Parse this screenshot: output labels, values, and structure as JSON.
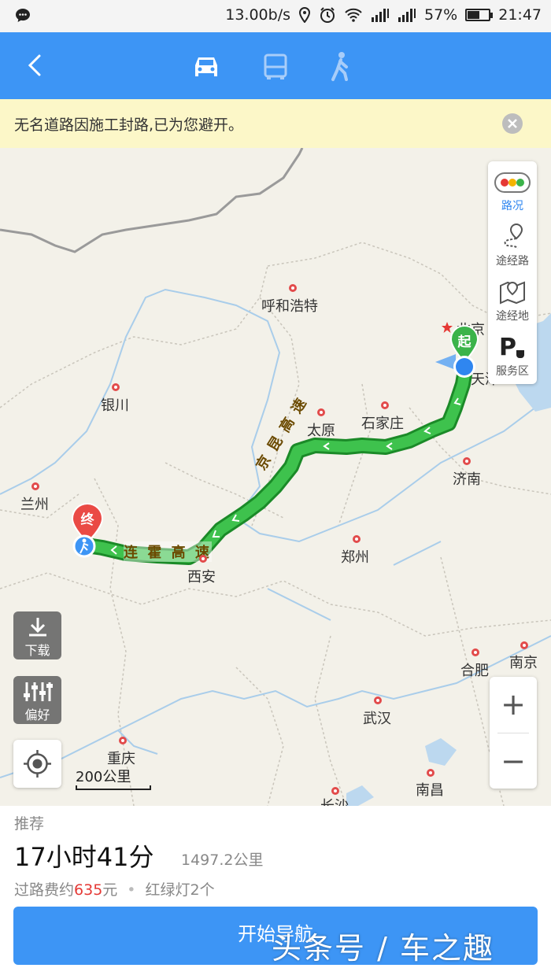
{
  "status_bar": {
    "speed": "13.00b/s",
    "battery": "57%",
    "time": "21:47",
    "icons": [
      "chat-icon",
      "location-icon",
      "alarm-icon",
      "wifi-icon",
      "signal-icon",
      "battery-icon"
    ]
  },
  "top_nav": {
    "modes": [
      {
        "name": "car",
        "icon": "car-icon",
        "active": true
      },
      {
        "name": "bus",
        "icon": "bus-icon",
        "active": false
      },
      {
        "name": "walk",
        "icon": "walk-icon",
        "active": false
      }
    ]
  },
  "notice": {
    "text": "无名道路因施工封路,已为您避开。"
  },
  "map": {
    "right_panel": [
      {
        "label": "路况",
        "icon": "traffic-light-icon"
      },
      {
        "label": "途经路",
        "icon": "route-icon"
      },
      {
        "label": "途经地",
        "icon": "map-pin-icon"
      },
      {
        "label": "服务区",
        "icon": "parking-icon"
      }
    ],
    "left_controls": {
      "download": "下载",
      "preference": "偏好"
    },
    "scale": "200公里",
    "route_labels": {
      "start_badge": "起",
      "end_badge": "终",
      "highway_1": [
        "京",
        "昆",
        "高",
        "速"
      ],
      "highway_2": [
        "连",
        "霍",
        "高",
        "速"
      ]
    },
    "cities": [
      {
        "name": "呼和浩特"
      },
      {
        "name": "北京"
      },
      {
        "name": "天津"
      },
      {
        "name": "银川"
      },
      {
        "name": "太原"
      },
      {
        "name": "石家庄"
      },
      {
        "name": "济南"
      },
      {
        "name": "兰州"
      },
      {
        "name": "郑州"
      },
      {
        "name": "西安"
      },
      {
        "name": "合肥"
      },
      {
        "name": "南京"
      },
      {
        "name": "武汉"
      },
      {
        "name": "重庆"
      },
      {
        "name": "南昌"
      },
      {
        "name": "长沙"
      }
    ]
  },
  "route": {
    "tag": "推荐",
    "duration": "17小时41分",
    "distance": "1497.2公里",
    "toll_prefix": "过路费约",
    "toll_amount": "635",
    "toll_unit": "元",
    "traffic_lights": "红绿灯2个",
    "start_button": "开始导航",
    "watermark": "头条号 / 车之趣"
  },
  "colors": {
    "accent": "#3d95f5",
    "route_green": "#2db83d",
    "notice_bg": "#fcf7c8",
    "toll_red": "#e53935"
  }
}
